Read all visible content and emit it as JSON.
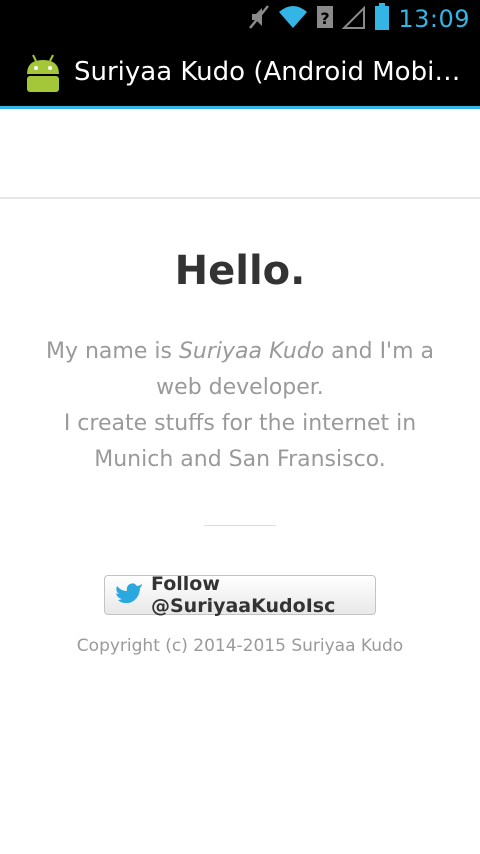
{
  "status_bar": {
    "time": "13:09",
    "icons": [
      "mute-icon",
      "wifi-icon",
      "sim-unknown-icon",
      "signal-icon",
      "battery-icon"
    ],
    "accent_color": "#33b5e5"
  },
  "action_bar": {
    "title": "Suriyaa Kudo (Android Mobile…",
    "app_icon": "android-icon",
    "accent_color": "#33b5e5"
  },
  "page": {
    "heading": "Hello.",
    "intro_prefix": "My name is ",
    "intro_name": "Suriyaa Kudo",
    "intro_suffix": " and I'm a web developer.",
    "intro_line2": "I create stuffs for the internet in Munich and San Fransisco.",
    "follow_button": "Follow @SuriyaaKudoIsc",
    "follow_icon": "twitter-bird-icon",
    "copyright": "Copyright (c) 2014-2015 Suriyaa Kudo"
  }
}
